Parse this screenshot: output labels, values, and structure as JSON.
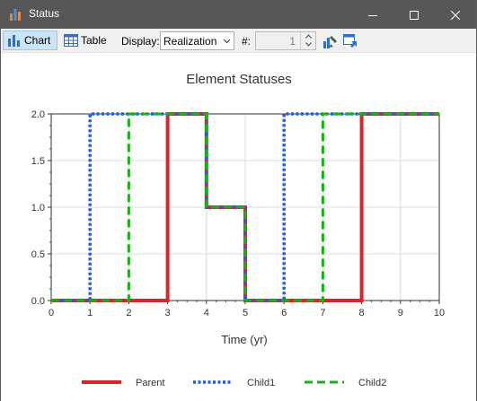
{
  "window": {
    "title": "Status",
    "icon": "bar-chart-app-icon"
  },
  "toolbar": {
    "chart_label": "Chart",
    "table_label": "Table",
    "display_label": "Display:",
    "display_value": "Realization",
    "realization_label": "#:",
    "realization_value": "1",
    "icons": [
      "chart-properties-icon",
      "export-icon"
    ]
  },
  "colors": {
    "titlebar": "#575757",
    "parent": "#e02128",
    "child1": "#1a5ee6",
    "child2": "#13b512",
    "grid": "#dcdcdc"
  },
  "chart_data": {
    "type": "line",
    "title": "Element Statuses",
    "xlabel": "Time (yr)",
    "ylabel": "",
    "xlim": [
      0,
      10
    ],
    "ylim": [
      0,
      2
    ],
    "x_ticks": [
      "0",
      "1",
      "2",
      "3",
      "4",
      "5",
      "6",
      "7",
      "8",
      "9",
      "10"
    ],
    "y_ticks": [
      "0.0",
      "0.5",
      "1.0",
      "1.5",
      "2.0"
    ],
    "grid": true,
    "legend_position": "bottom",
    "series": [
      {
        "name": "Parent",
        "style": "solid",
        "points": [
          [
            0,
            0
          ],
          [
            3,
            0
          ],
          [
            3,
            2
          ],
          [
            4,
            2
          ],
          [
            4,
            1
          ],
          [
            5,
            1
          ],
          [
            5,
            0
          ],
          [
            8,
            0
          ],
          [
            8,
            2
          ],
          [
            10,
            2
          ]
        ]
      },
      {
        "name": "Child1",
        "style": "dotted",
        "points": [
          [
            0,
            0
          ],
          [
            1,
            0
          ],
          [
            1,
            2
          ],
          [
            4,
            2
          ],
          [
            4,
            1
          ],
          [
            5,
            1
          ],
          [
            5,
            0
          ],
          [
            6,
            0
          ],
          [
            6,
            2
          ],
          [
            10,
            2
          ]
        ]
      },
      {
        "name": "Child2",
        "style": "dashed",
        "points": [
          [
            0,
            0
          ],
          [
            2,
            0
          ],
          [
            2,
            2
          ],
          [
            4,
            2
          ],
          [
            4,
            1
          ],
          [
            5,
            1
          ],
          [
            5,
            0
          ],
          [
            7,
            0
          ],
          [
            7,
            2
          ],
          [
            10,
            2
          ]
        ]
      }
    ]
  }
}
